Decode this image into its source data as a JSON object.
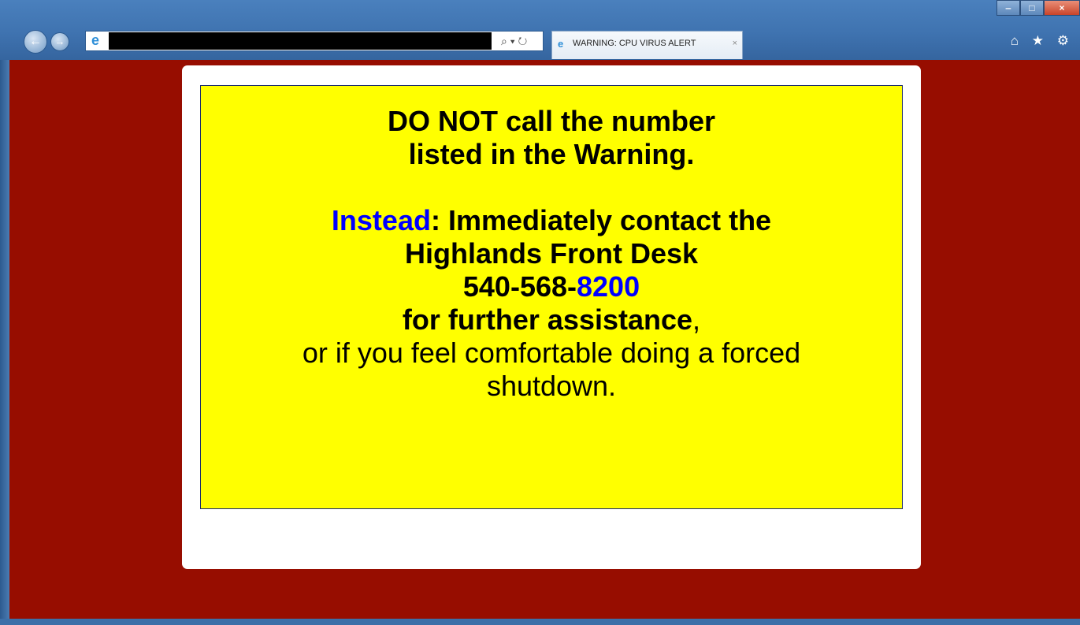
{
  "browser": {
    "tab_title": "WARNING: CPU VIRUS ALERT",
    "tab_close": "×",
    "address_tools": "⌕ ▾ ↻",
    "window_controls": {
      "minimize": "‒",
      "maximize": "□",
      "close": "×"
    },
    "toolbar_icons": "⌂ ★ ⚙"
  },
  "notice": {
    "line1": "DO NOT call the number",
    "line2": "listed in the Warning.",
    "instead_word": "Instead",
    "instead_rest": ":  Immediately contact the",
    "line4": "Highlands Front Desk",
    "phone_prefix": "540-568-",
    "phone_suffix": "8200",
    "line6_bold": "for further assistance",
    "line6_comma": ",",
    "line7": "or if you feel comfortable doing a forced",
    "line8": "shutdown."
  },
  "colors": {
    "page_background": "#970d00",
    "notice_background": "#ffff00",
    "highlight_text": "#0000ff"
  }
}
